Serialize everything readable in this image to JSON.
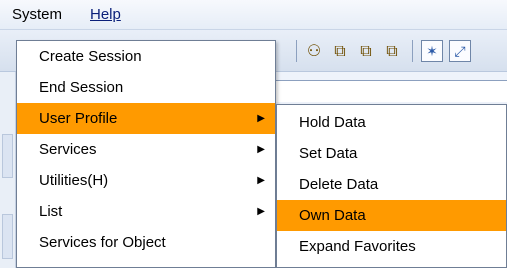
{
  "menubar": {
    "items": [
      {
        "label": "System"
      },
      {
        "label": "Help"
      }
    ]
  },
  "toolbar": {
    "icons": [
      {
        "name": "create-session-icon",
        "glyph": "⚇"
      },
      {
        "name": "copy-icon",
        "glyph": "⧉"
      },
      {
        "name": "paste-icon",
        "glyph": "⧉"
      },
      {
        "name": "print-icon",
        "glyph": "⧉"
      },
      {
        "name": "help-icon",
        "glyph": "✶"
      },
      {
        "name": "layout-icon",
        "glyph": "⤢"
      }
    ]
  },
  "system_menu": {
    "items": [
      {
        "label": "Create Session",
        "has_submenu": false,
        "highlighted": false
      },
      {
        "label": "End Session",
        "has_submenu": false,
        "highlighted": false
      },
      {
        "label": "User Profile",
        "has_submenu": true,
        "highlighted": true
      },
      {
        "label": "Services",
        "has_submenu": true,
        "highlighted": false
      },
      {
        "label": "Utilities(H)",
        "has_submenu": true,
        "highlighted": false
      },
      {
        "label": "List",
        "has_submenu": true,
        "highlighted": false
      },
      {
        "label": "Services for Object",
        "has_submenu": false,
        "highlighted": false
      }
    ],
    "submenu_arrow": "▶"
  },
  "user_profile_menu": {
    "items": [
      {
        "label": "Hold Data",
        "highlighted": false
      },
      {
        "label": "Set Data",
        "highlighted": false
      },
      {
        "label": "Delete Data",
        "highlighted": false
      },
      {
        "label": "Own Data",
        "highlighted": true
      },
      {
        "label": "Expand Favorites",
        "highlighted": false
      }
    ]
  },
  "colors": {
    "highlight": "#ff9a00",
    "menu_border": "#6f7e95",
    "background": "#eef3fb"
  }
}
